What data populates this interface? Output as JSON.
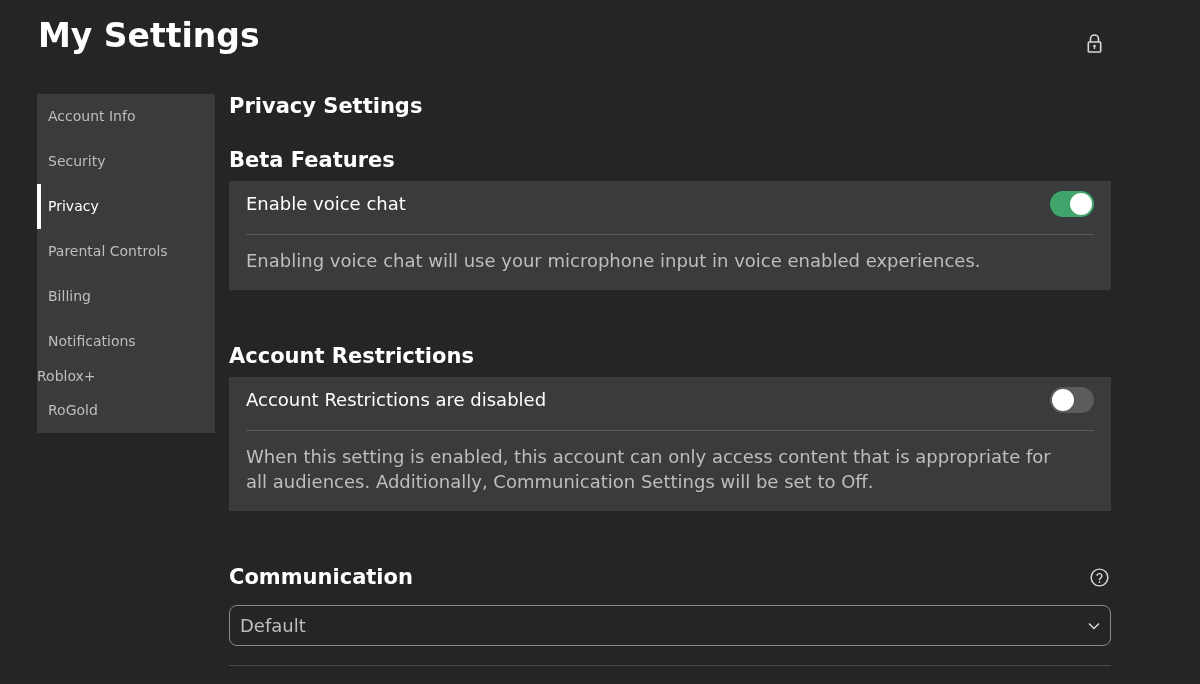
{
  "page": {
    "title": "My Settings"
  },
  "sidebar": {
    "items": [
      {
        "label": "Account Info",
        "kind": "tab",
        "selected": false
      },
      {
        "label": "Security",
        "kind": "tab",
        "selected": false
      },
      {
        "label": "Privacy",
        "kind": "tab",
        "selected": true
      },
      {
        "label": "Parental Controls",
        "kind": "tab",
        "selected": false
      },
      {
        "label": "Billing",
        "kind": "tab",
        "selected": false
      },
      {
        "label": "Notifications",
        "kind": "tab",
        "selected": false
      },
      {
        "label": "Roblox+",
        "kind": "extension",
        "selected": false
      },
      {
        "label": "RoGold",
        "kind": "tab",
        "selected": false
      }
    ]
  },
  "content": {
    "heading": "Privacy Settings",
    "sections": [
      {
        "kind": "toggle",
        "title": "Beta Features",
        "label": "Enable voice chat",
        "on": true,
        "description": "Enabling voice chat will use your microphone input in voice enabled experiences."
      },
      {
        "kind": "toggle",
        "title": "Account Restrictions",
        "label": "Account Restrictions are disabled",
        "on": false,
        "description": "When this setting is enabled, this account can only access content that is appropriate for all audiences. Additionally, Communication Settings will be set to Off."
      },
      {
        "kind": "select",
        "title": "Communication",
        "help": true,
        "value": "Default"
      }
    ]
  }
}
